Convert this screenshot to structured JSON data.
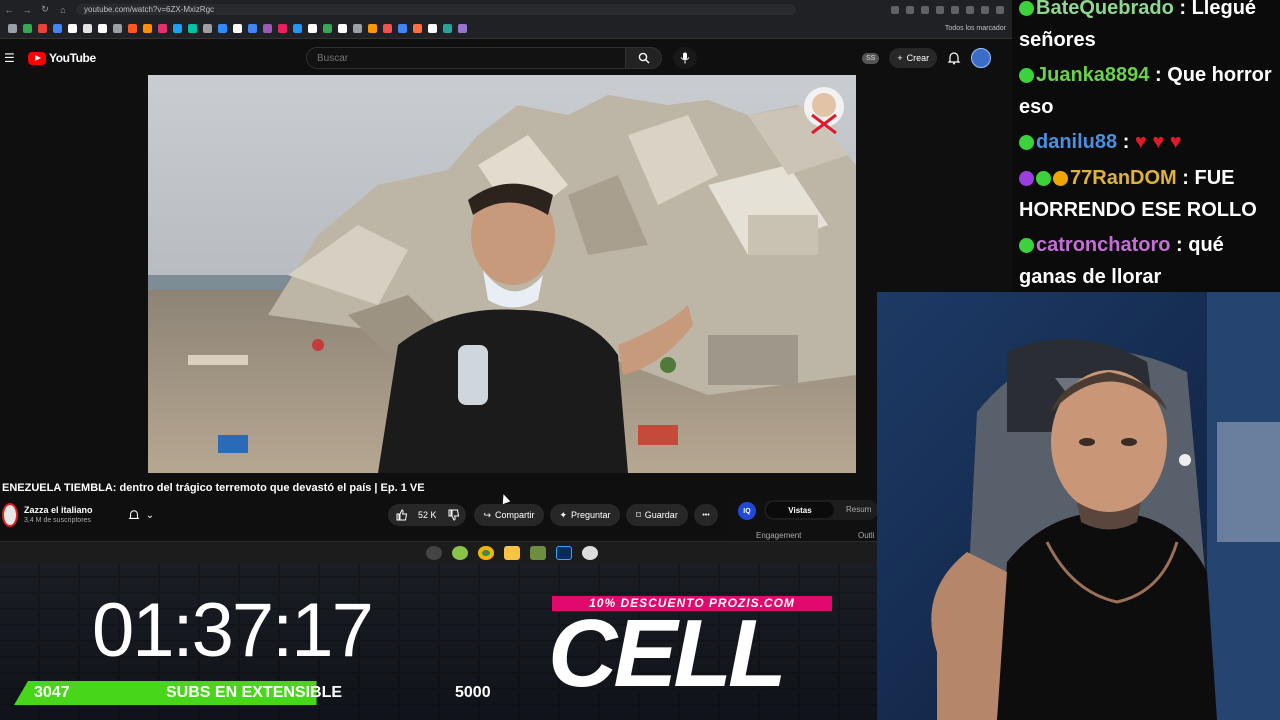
{
  "browser": {
    "url": "youtube.com/watch?v=6ZX-MxizRgc",
    "bookmarks_all_label": "Todos los marcador",
    "colors": {
      "frame": "#202124"
    }
  },
  "youtube": {
    "logo_text": "YouTube",
    "search_placeholder": "Buscar",
    "ss_badge": "SS",
    "create_label": "Crear",
    "video_title": "ENEZUELA TIEMBLA: dentro del trágico terremoto que devastó el país | Ep. 1 VE",
    "channel_name": "Zazza el italiano",
    "channel_subs": "3,4 M de suscriptores",
    "likes": "52 K",
    "share_label": "Compartir",
    "ask_label": "Preguntar",
    "save_label": "Guardar",
    "more_label": "•••",
    "panel": {
      "logo": "IQ",
      "tab_active": "Vistas",
      "tab_other": "Resum",
      "label_left": "Engagement",
      "label_right": "Outli"
    },
    "icons": [
      "menu-icon",
      "search-icon",
      "mic-icon",
      "plus-icon",
      "bell-icon",
      "like-icon",
      "dislike-icon",
      "share-icon",
      "sparkle-icon",
      "bookmark-icon"
    ]
  },
  "overlay": {
    "timer": "01:37:17",
    "subs_current": "3047",
    "subs_label": "SUBS EN EXTENSIBLE",
    "subs_goal": "5000",
    "subs_progress": 0.61,
    "promo_text": "10% DESCUENTO PROZIS.COM",
    "brand": "CELL",
    "colors": {
      "progress": "#48d61a",
      "promo": "#e10a6c"
    }
  },
  "chat": {
    "messages": [
      {
        "user": "BateQuebrado",
        "text": " : Llegué señores",
        "color": "#8fd78f",
        "badges": [
          "green"
        ]
      },
      {
        "user": "Juanka8894",
        "text": " : Que horror eso",
        "color": "#6ad14a",
        "badges": [
          "green"
        ]
      },
      {
        "user": "danilu88",
        "text": " : ",
        "hearts": "♥ ♥ ♥",
        "color": "#4a90e2",
        "badges": [
          "green"
        ]
      },
      {
        "user": "77RanDOM",
        "text": " : FUE HORRENDO ESE ROLLO",
        "color": "#e0b23a",
        "badges": [
          "purple",
          "green",
          "orange"
        ]
      },
      {
        "user": "catronchatoro",
        "text": " : qué ganas de llorar",
        "color": "#c46fd6",
        "badges": [
          "green"
        ]
      }
    ]
  }
}
